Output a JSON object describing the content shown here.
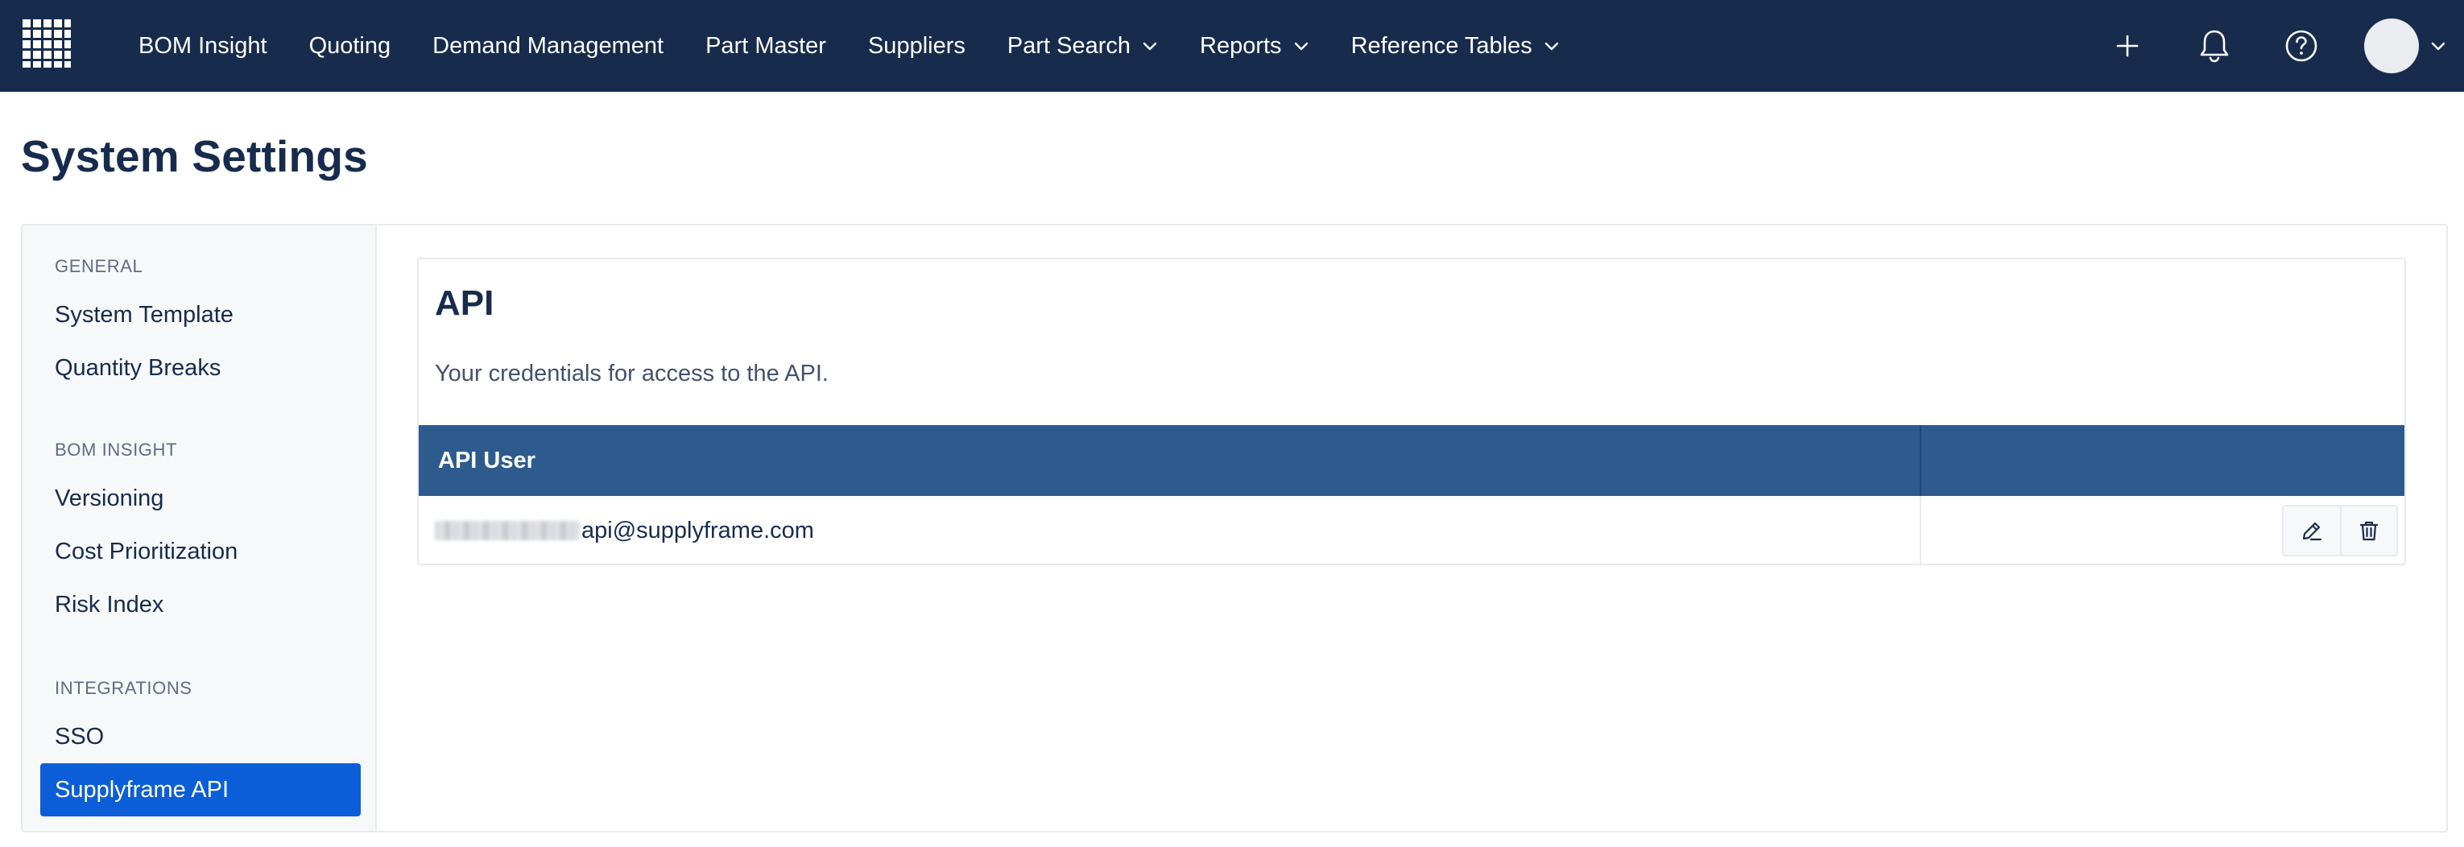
{
  "nav": {
    "logo_icon": "grid-logo-icon",
    "items": [
      {
        "label": "BOM Insight"
      },
      {
        "label": "Quoting"
      },
      {
        "label": "Demand Management"
      },
      {
        "label": "Part Master"
      },
      {
        "label": "Suppliers"
      },
      {
        "label": "Part Search",
        "dropdown": true
      },
      {
        "label": "Reports",
        "dropdown": true
      },
      {
        "label": "Reference Tables",
        "dropdown": true
      }
    ],
    "right_icons": [
      "plus-icon",
      "bell-icon",
      "help-icon",
      "avatar"
    ]
  },
  "page": {
    "title": "System Settings"
  },
  "sidebar": {
    "sections": [
      {
        "heading": "GENERAL",
        "items": [
          "System Template",
          "Quantity Breaks"
        ]
      },
      {
        "heading": "BOM INSIGHT",
        "items": [
          "Versioning",
          "Cost Prioritization",
          "Risk Index"
        ]
      },
      {
        "heading": "INTEGRATIONS",
        "items": [
          "SSO",
          "Supplyframe API"
        ]
      }
    ],
    "active_item": "Supplyframe API"
  },
  "api_card": {
    "title": "API",
    "description": "Your credentials for access to the API.",
    "table": {
      "columns": [
        "API User",
        ""
      ],
      "rows": [
        {
          "user_suffix": "api@supplyframe.com",
          "actions": [
            "edit-icon",
            "trash-icon"
          ]
        }
      ]
    }
  },
  "colors": {
    "nav_bg": "#172b4d",
    "table_header_bg": "#2d5b8e",
    "active_item_bg": "#0b5ed7"
  }
}
